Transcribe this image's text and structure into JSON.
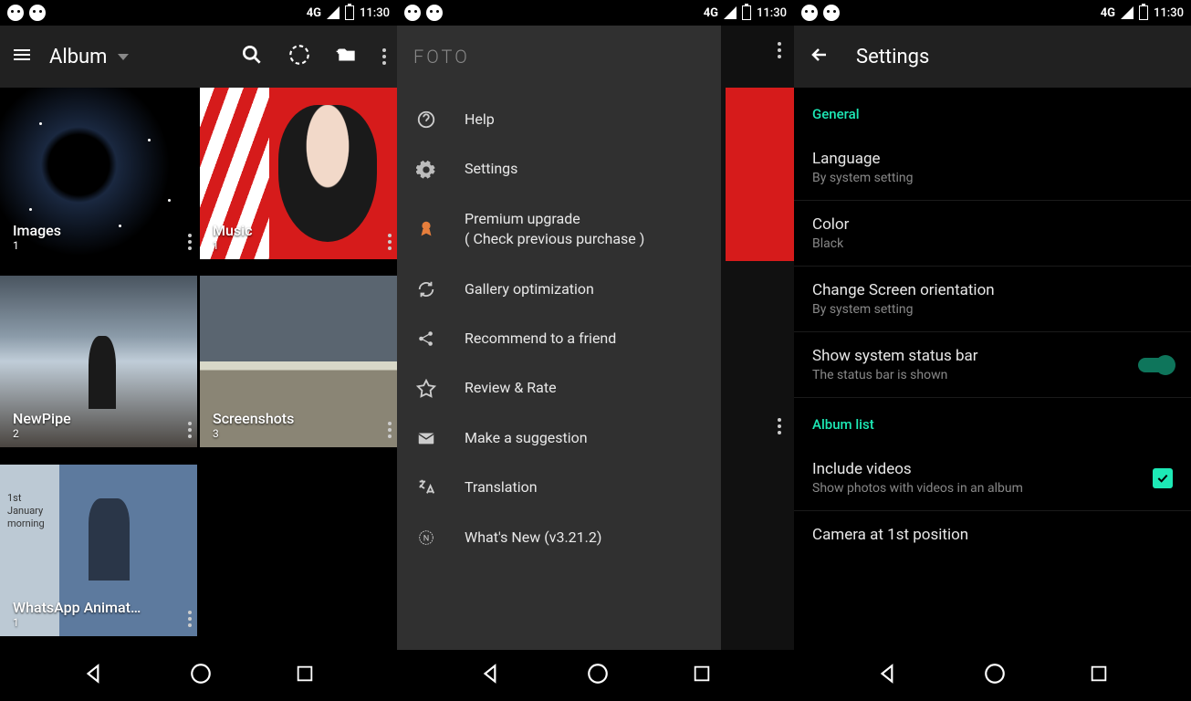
{
  "status": {
    "network": "4G",
    "time": "11:30"
  },
  "phone1": {
    "title": "Album",
    "albums": [
      {
        "name": "Images",
        "count": "1"
      },
      {
        "name": "Music",
        "count": "1"
      },
      {
        "name": "NewPipe",
        "count": "2"
      },
      {
        "name": "Screenshots",
        "count": "3"
      },
      {
        "name": "WhatsApp Animat…",
        "count": "1"
      }
    ]
  },
  "phone2": {
    "logo": "FOTO",
    "items": [
      {
        "icon": "help",
        "label": "Help"
      },
      {
        "icon": "settings",
        "label": "Settings"
      },
      {
        "icon": "premium",
        "label": "Premium upgrade\n( Check previous purchase )"
      },
      {
        "icon": "sync",
        "label": "Gallery optimization"
      },
      {
        "icon": "share",
        "label": "Recommend to a friend"
      },
      {
        "icon": "star",
        "label": "Review & Rate"
      },
      {
        "icon": "mail",
        "label": "Make a suggestion"
      },
      {
        "icon": "translate",
        "label": "Translation"
      },
      {
        "icon": "new",
        "label": "What's New (v3.21.2)"
      }
    ]
  },
  "phone3": {
    "title": "Settings",
    "sections": {
      "general": "General",
      "albumlist": "Album list"
    },
    "items": [
      {
        "title": "Language",
        "sub": "By system setting"
      },
      {
        "title": "Color",
        "sub": "Black"
      },
      {
        "title": "Change Screen orientation",
        "sub": "By system setting"
      },
      {
        "title": "Show system status bar",
        "sub": "The status bar is shown",
        "toggle": true
      },
      {
        "title": "Include videos",
        "sub": "Show photos with videos in an album",
        "check": true
      },
      {
        "title": "Camera at 1st position",
        "sub": ""
      }
    ]
  }
}
